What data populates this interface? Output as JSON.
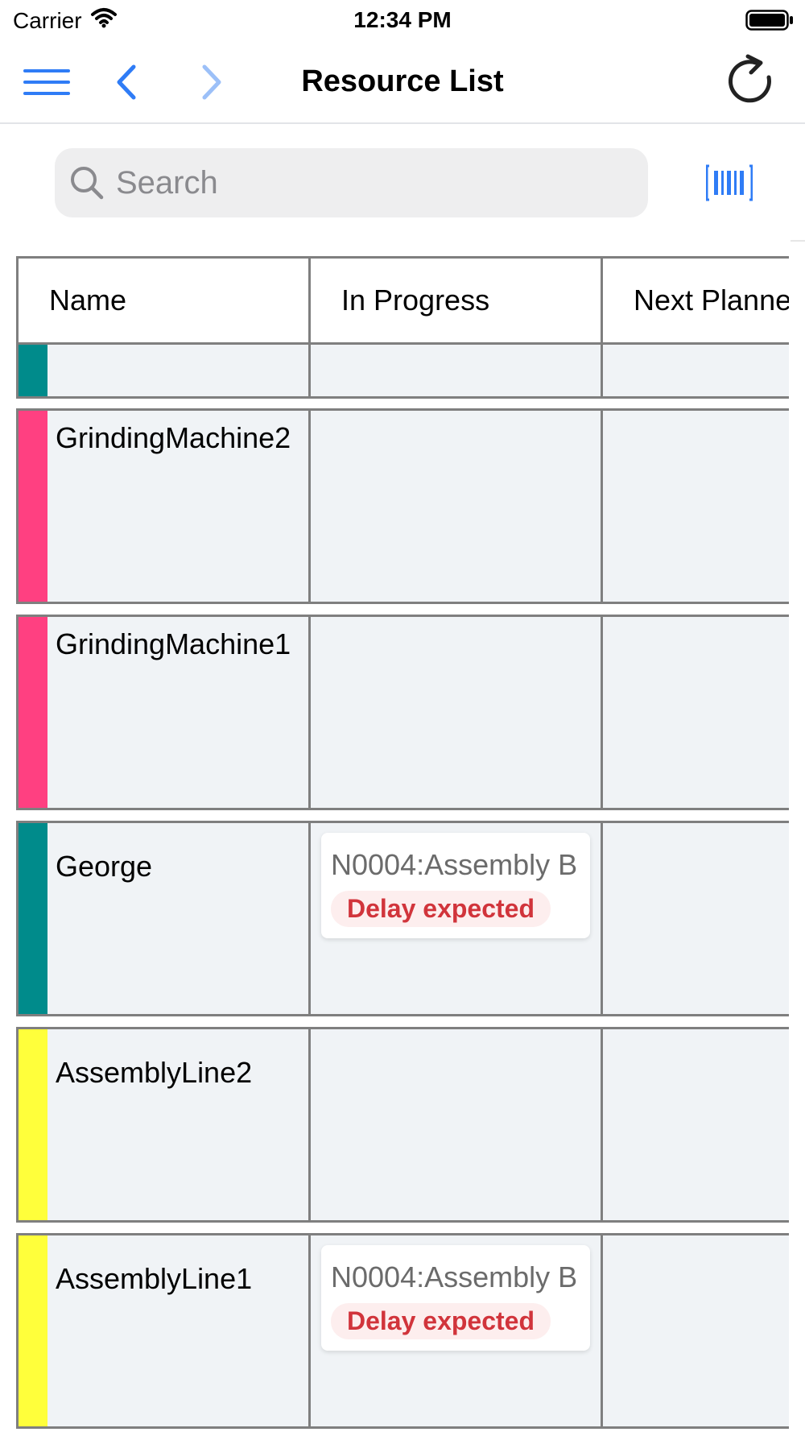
{
  "status_bar": {
    "carrier": "Carrier",
    "time": "12:34 PM"
  },
  "nav": {
    "title": "Resource List"
  },
  "search": {
    "placeholder": "Search",
    "value": ""
  },
  "table": {
    "columns": [
      "Name",
      "In Progress",
      "Next Planne"
    ],
    "rows": [
      {
        "name": "",
        "color": "#008b8b",
        "task": null,
        "badge": null
      },
      {
        "name": "GrindingMachine2",
        "color": "#ff4081",
        "task": null,
        "badge": null
      },
      {
        "name": "GrindingMachine1",
        "color": "#ff4081",
        "task": null,
        "badge": null
      },
      {
        "name": "George",
        "color": "#008b8b",
        "task": "N0004:Assembly B",
        "badge": "Delay expected"
      },
      {
        "name": "AssemblyLine2",
        "color": "#ffff3b",
        "task": null,
        "badge": null
      },
      {
        "name": "AssemblyLine1",
        "color": "#ffff3b",
        "task": "N0004:Assembly B",
        "badge": "Delay expected"
      }
    ]
  },
  "colors": {
    "accent": "#2f7cf6",
    "accent_light": "#9cc0f8",
    "delay_text": "#d1343b",
    "delay_bg": "#fdeeee",
    "grid": "#7f7f7f",
    "row_bg": "#f0f3f6"
  },
  "icons": [
    "wifi-icon",
    "battery-icon",
    "hamburger-menu-icon",
    "chevron-left-icon",
    "chevron-right-icon",
    "refresh-icon",
    "search-icon",
    "barcode-icon"
  ]
}
